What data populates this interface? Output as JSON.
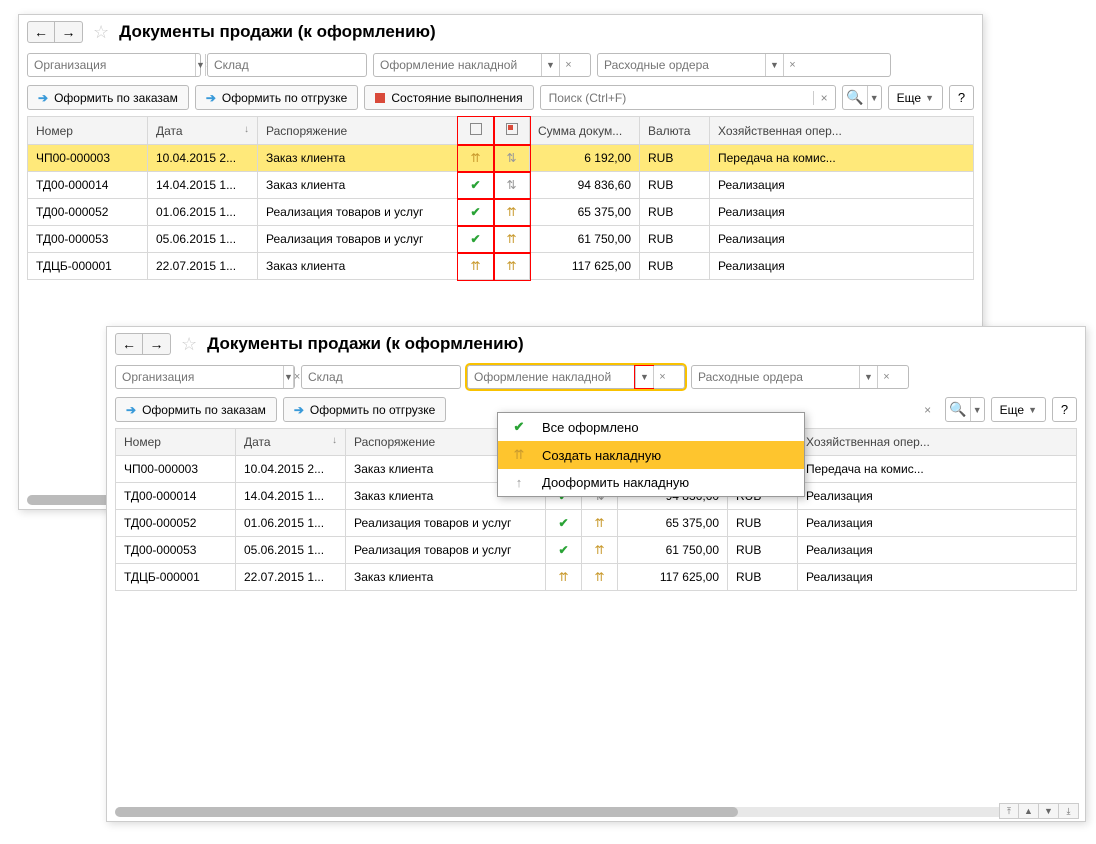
{
  "title": "Документы продажи (к оформлению)",
  "filters": {
    "org": "Организация",
    "warehouse": "Склад",
    "warehouse_ellipsis": "...",
    "invoice": "Оформление накладной",
    "orders": "Расходные ордера"
  },
  "toolbar": {
    "by_orders": "Оформить по заказам",
    "by_ship": "Оформить по отгрузке",
    "status": "Состояние выполнения",
    "search_ph": "Поиск (Ctrl+F)",
    "more": "Еще"
  },
  "cols": {
    "num": "Номер",
    "date": "Дата",
    "order": "Распоряжение",
    "sum": "Сумма докум...",
    "currency": "Валюта",
    "op": "Хозяйственная опер..."
  },
  "rows": [
    {
      "num": "ЧП00-000003",
      "date": "10.04.2015 2...",
      "order": "Заказ клиента",
      "ic1": "up-o",
      "ic2": "ud-g",
      "sum": "6 192,00",
      "cur": "RUB",
      "op": "Передача на комис..."
    },
    {
      "num": "ТД00-000014",
      "date": "14.04.2015 1...",
      "order": "Заказ клиента",
      "ic1": "ok",
      "ic2": "ud-g",
      "sum": "94 836,60",
      "cur": "RUB",
      "op": "Реализация"
    },
    {
      "num": "ТД00-000052",
      "date": "01.06.2015 1...",
      "order": "Реализация товаров и услуг",
      "ic1": "ok",
      "ic2": "up-o",
      "sum": "65 375,00",
      "cur": "RUB",
      "op": "Реализация"
    },
    {
      "num": "ТД00-000053",
      "date": "05.06.2015 1...",
      "order": "Реализация товаров и услуг",
      "ic1": "ok",
      "ic2": "up-o",
      "sum": "61 750,00",
      "cur": "RUB",
      "op": "Реализация"
    },
    {
      "num": "ТДЦБ-000001",
      "date": "22.07.2015 1...",
      "order": "Заказ клиента",
      "ic1": "up-o",
      "ic2": "up-o",
      "sum": "117 625,00",
      "cur": "RUB",
      "op": "Реализация"
    }
  ],
  "dropdown": {
    "all": "Все оформлено",
    "create": "Создать накладную",
    "finish": "Дооформить накладную"
  }
}
